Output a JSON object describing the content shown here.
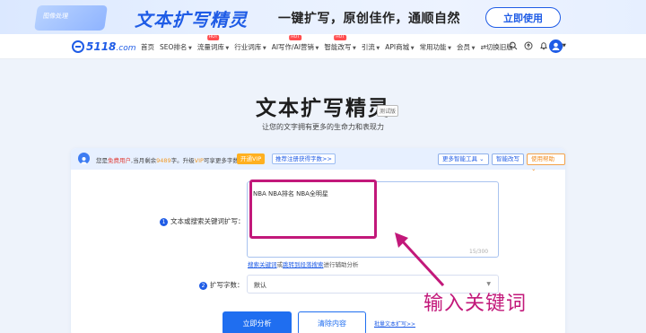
{
  "banner": {
    "title": "文本扩写精灵",
    "slogan": "一键扩写，原创佳作，通顺自然",
    "cta": "立即使用",
    "art_tag": "图像处理"
  },
  "nav": {
    "logo_main": "5118",
    "logo_suffix": ".com",
    "items": [
      {
        "label": "首页",
        "caret": false,
        "hot": false
      },
      {
        "label": "SEO排名",
        "caret": true,
        "hot": false
      },
      {
        "label": "流量词库",
        "caret": true,
        "hot": true
      },
      {
        "label": "行业词库",
        "caret": true,
        "hot": false
      },
      {
        "label": "AI写作/AI营销",
        "caret": true,
        "hot": true
      },
      {
        "label": "智能改写",
        "caret": true,
        "hot": true
      },
      {
        "label": "引流",
        "caret": true,
        "hot": false
      },
      {
        "label": "API商城",
        "caret": true,
        "hot": false
      },
      {
        "label": "常用功能",
        "caret": true,
        "hot": false
      },
      {
        "label": "会员",
        "caret": true,
        "hot": false
      },
      {
        "label": "⇄切换旧版",
        "caret": false,
        "hot": false
      }
    ],
    "hot_label": "HOT",
    "icons": [
      "search-icon",
      "upload-icon",
      "bell-icon",
      "help-icon"
    ]
  },
  "hero": {
    "title": "文本扩写精灵",
    "badge": "测试版",
    "subtitle": "让您的文字拥有更多的生命力和表现力"
  },
  "infobar": {
    "text_a": "您是",
    "user_type": "免费用户",
    "text_b": ",当月剩余",
    "remaining": "9489",
    "text_c": "字。升级",
    "vip_word": "VIP",
    "text_d": "可享更多字数",
    "vip_button": "开通VIP",
    "promo_link": "推荐注册获得字数>>",
    "more_tools": "更多智能工具",
    "smart_rewrite": "智能改写",
    "help": "使用帮助"
  },
  "form": {
    "field1_num": "1",
    "field1_label": "文本或搜索关键词扩写：",
    "input_value": "NBA NBA排名 NBA全明星",
    "counter": "15/300",
    "hint_link1": "搜索关键词",
    "hint_or": "或",
    "hint_link2": "跳转到段落搜索",
    "hint_tail": "进行辅助分析",
    "field2_num": "2",
    "field2_label": "扩写字数：",
    "select_value": "默认",
    "analyze_button": "立即分析",
    "clear_button": "清除内容",
    "batch_link": "批量文本扩写>>"
  },
  "annotation": {
    "text": "输入关键词",
    "color": "#c2187a"
  }
}
